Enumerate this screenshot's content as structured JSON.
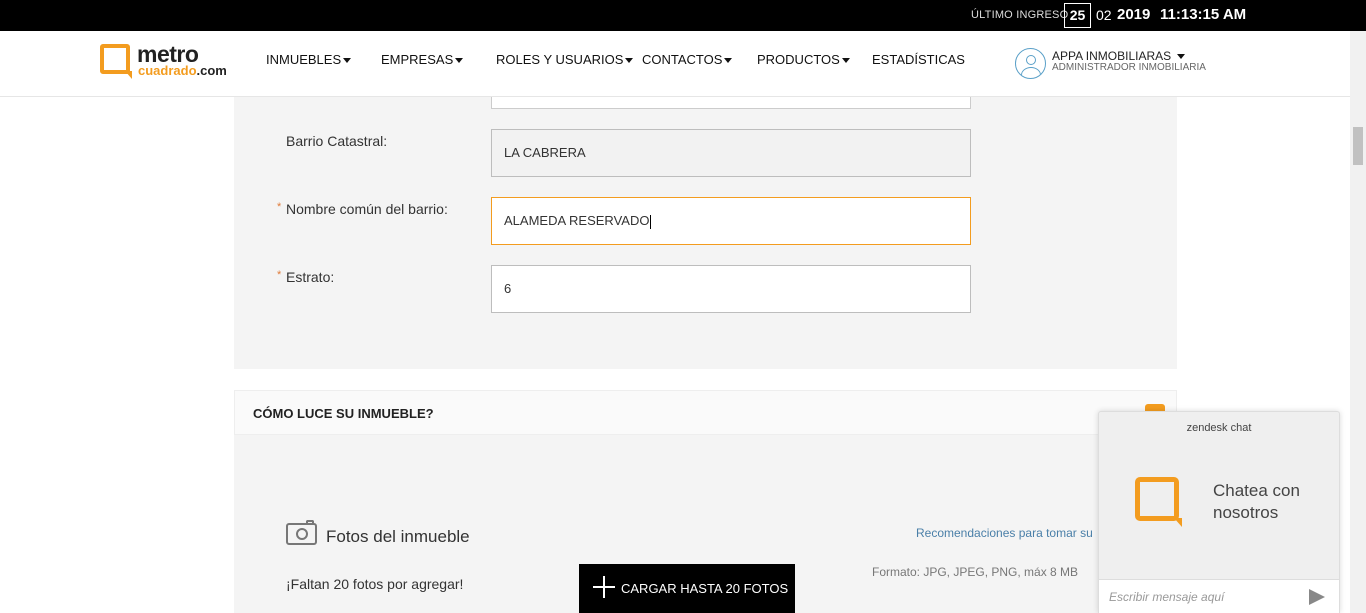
{
  "topbar": {
    "last_login_label": "ÚLTIMO INGRESO",
    "day": "25",
    "month": "02",
    "year": "2019",
    "time": "11:13:15 AM"
  },
  "logo": {
    "line1": "metro",
    "line2": "cuadrado",
    "line2_suffix": ".com"
  },
  "nav": {
    "items": [
      {
        "label": "INMUEBLES",
        "dropdown": true
      },
      {
        "label": "EMPRESAS",
        "dropdown": true
      },
      {
        "label": "ROLES Y USUARIOS",
        "dropdown": true
      },
      {
        "label": "CONTACTOS",
        "dropdown": true
      },
      {
        "label": "PRODUCTOS",
        "dropdown": true
      },
      {
        "label": "ESTADÍSTICAS",
        "dropdown": false
      }
    ]
  },
  "user": {
    "name": "APPA INMOBILIARAS",
    "role": "ADMINISTRADOR INMOBILIARIA"
  },
  "form": {
    "barrio_catastral": {
      "label": "Barrio Catastral:",
      "value": "LA CABRERA"
    },
    "nombre_barrio": {
      "label": "Nombre común del barrio:",
      "value": "ALAMEDA RESERVADO",
      "required_mark": "*"
    },
    "estrato": {
      "label": "Estrato:",
      "value": "6",
      "required_mark": "*"
    }
  },
  "section2": {
    "title": "CÓMO LUCE SU INMUEBLE?",
    "photos_title": "Fotos del inmueble",
    "photos_missing": "¡Faltan 20 fotos por agregar!",
    "upload_label": "CARGAR HASTA 20 FOTOS",
    "recommendations_link": "Recomendaciones para tomar su",
    "format_note": "Formato: JPG, JPEG, PNG, máx 8 MB"
  },
  "chat": {
    "brand": "zendesk chat",
    "message": "Chatea con nosotros",
    "placeholder": "Escribir mensaje aquí"
  },
  "colors": {
    "accent": "#f39c1f",
    "link": "#4a7fa8"
  }
}
